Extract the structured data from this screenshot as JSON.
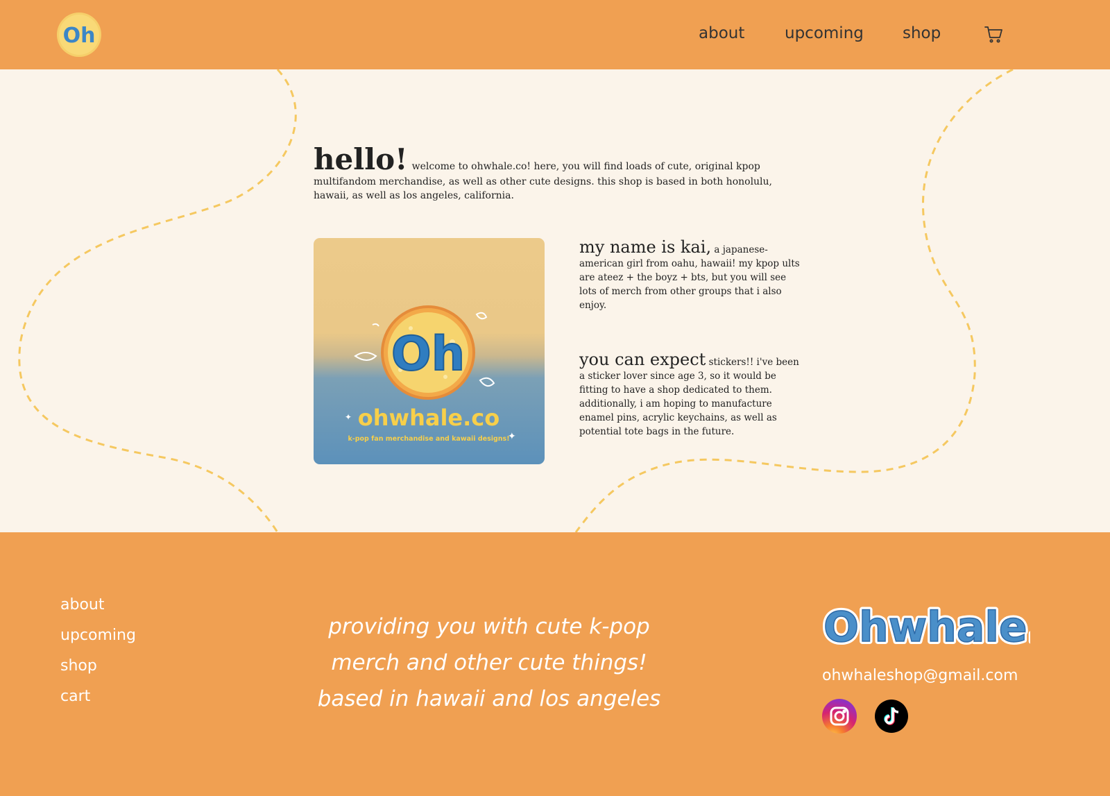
{
  "header": {
    "logo_alt": "Oh",
    "nav": [
      {
        "label": "about"
      },
      {
        "label": "upcoming"
      },
      {
        "label": "shop"
      }
    ],
    "cart_icon": "cart-icon"
  },
  "main": {
    "hello_title": "hello!",
    "hello_text": "welcome to ohwhale.co! here, you will find loads of cute, original kpop multifandom merchandise, as well as other cute designs. this shop is based in both honolulu, hawaii, as well as los angeles, california.",
    "image": {
      "brand": "ohwhale.co",
      "subtitle": "k-pop fan merchandise and kawaii designs!",
      "badge": "Oh"
    },
    "kai_lead": "my name is kai,",
    "kai_text": "a japanese-american girl from oahu, hawaii! my kpop ults are ateez + the boyz + bts, but you will see lots of merch from other groups that i also enjoy.",
    "expect_lead": "you can expect",
    "expect_text": "stickers!! i've been a sticker lover since age 3, so it would be fitting to have a shop dedicated to them. additionally, i am hoping to manufacture enamel pins, acrylic keychains, as well as potential tote bags in the future."
  },
  "footer": {
    "nav": [
      {
        "label": "about"
      },
      {
        "label": "upcoming"
      },
      {
        "label": "shop"
      },
      {
        "label": "cart"
      }
    ],
    "tagline": [
      "providing you with cute k-pop",
      "merch and other cute things!",
      "based in hawaii and los angeles"
    ],
    "wordmark": "Ohwhale.co",
    "email": "ohwhaleshop@gmail.com",
    "social": [
      {
        "name": "instagram-icon"
      },
      {
        "name": "tiktok-icon"
      }
    ]
  },
  "colors": {
    "orange": "#f0a052",
    "cream": "#fbf4ea",
    "dash": "#f5c860",
    "blue": "#4a8fc9"
  }
}
